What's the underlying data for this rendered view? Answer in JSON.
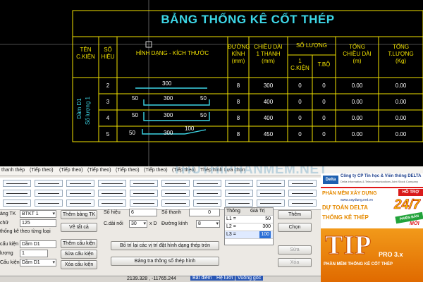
{
  "cad": {
    "title": "BẢNG THỐNG KÊ CỐT THÉP",
    "headers": {
      "ten": "TÊN\nC.KIỆN",
      "so_hieu": "SỐ\nHIỆU",
      "hinh_dang": "HÌNH DẠNG - KÍCH THƯỚC",
      "duong_kinh": "ĐƯỜNG\nKÍNH\n(mm)",
      "chieu_dai": "CHIỀU DÀI\n1 THANH\n(mm)",
      "so_luong": "SỐ LƯỢNG",
      "ck": "1\nC.KIỆN",
      "tb": "T.BỘ",
      "tong_dai": "TỔNG\nCHIỀU DÀI\n(m)",
      "tong_luong": "TỔNG\nT.LƯỢNG\n(Kg)"
    },
    "member_name": "Dầm D1",
    "member_count": "Số lượng 1",
    "rows": [
      {
        "id": "2",
        "dims": [
          "300"
        ],
        "dk": "8",
        "cd": "300",
        "ck": "0",
        "tb": "0",
        "td": "0.00",
        "tl": "0.00"
      },
      {
        "id": "3",
        "dims": [
          "50",
          "300",
          "50"
        ],
        "dk": "8",
        "cd": "400",
        "ck": "0",
        "tb": "0",
        "td": "0.00",
        "tl": "0.00"
      },
      {
        "id": "4",
        "dims": [
          "50",
          "300",
          "50"
        ],
        "dk": "8",
        "cd": "400",
        "ck": "0",
        "tb": "0",
        "td": "0.00",
        "tl": "0.00"
      },
      {
        "id": "5",
        "dims": [
          "50",
          "300",
          "100"
        ],
        "dk": "8",
        "cd": "450",
        "ck": "0",
        "tb": "0",
        "td": "0.00",
        "tl": "0.00"
      }
    ]
  },
  "ui": {
    "tabs": [
      "thanh thép",
      "(Tiếp theo)",
      "(Tiếp theo)",
      "(Tiếp theo)",
      "(Tiếp theo)",
      "(Tiếp theo)",
      "(Tiếp theo)",
      "Thép hình",
      "Lựa chọn"
    ],
    "watermark": "THUTHIPHANMEM.NET",
    "left": {
      "bang_tk_label": "ảng TK",
      "bang_tk_value": "BTKT 1",
      "chu_label": "chữ",
      "chu_value": "125",
      "thong_ke_label": "thống kê theo từng loại",
      "cau_kien_label": "cấu kiện",
      "cau_kien_value": "Dầm D1",
      "luong_label": "lượng",
      "luong_value": "1",
      "cau_kien2_label": "Cấu kiện",
      "cau_kien2_value": "Dầm D1",
      "btn_them_bang": "Thêm bảng TK",
      "btn_ve_tat_ca": "Vẽ tất cả",
      "btn_them_ck": "Thêm cấu kiện",
      "btn_sua_ck": "Sửa cấu kiện",
      "btn_xoa_ck": "Xóa cấu kiện"
    },
    "mid": {
      "so_hieu_label": "Số hiệu",
      "so_hieu_value": "6",
      "so_thanh_label": "Số thanh",
      "so_thanh_value": "0",
      "cdai_label": "C.dài nối",
      "cdai_value": "30",
      "xd_label": "x D",
      "duong_kinh_label": "Đường kính",
      "duong_kinh_value": "8",
      "btn_bo_tri": "Bố trí lại các vị trí đặt hình dạng thép tròn",
      "btn_bang_tra": "Bảng tra thông số thép hình"
    },
    "grid": {
      "col1": "Thông",
      "col2": "Giá Trị",
      "rows": [
        {
          "k": "L1 =",
          "v": "50"
        },
        {
          "k": "L2 =",
          "v": "300"
        },
        {
          "k": "L3 =",
          "v": "100"
        }
      ]
    },
    "right_buttons": {
      "them": "Thêm",
      "chon": "Chọn",
      "sua": "Sửa",
      "xoa": "Xóa"
    },
    "status": {
      "coords": "2139.328 , -11765.244",
      "b1": "Bắt điểm",
      "b2": "Hệ lưới",
      "b3": "Vuông góc"
    },
    "ad": {
      "company": "Công ty CP Tin học & Viễn thông DELTA",
      "company_en": "Delta Informatics & Telecommunications Joint Stock Company",
      "logo": "Delta",
      "line1": "PHẦN MỀM XÂY DỰNG",
      "site": "www.xaydung.net.vn",
      "ho_tro": "HỖ TRỢ",
      "line2": "DỰ TOÁN DELTA",
      "line3": "THỐNG KÊ THÉP",
      "big": "24/7",
      "phien_ban": "PHIÊN BẢN",
      "moi": "MỚI",
      "tip": "TIP",
      "pro": "PRO 3.x",
      "tagline": "PHẦN MỀM THỐNG KÊ CỐT THÉP"
    }
  },
  "colors": {
    "cyan": "#3dd6e6",
    "yellow": "#f2e200",
    "ui_bg": "#ece9e4"
  }
}
